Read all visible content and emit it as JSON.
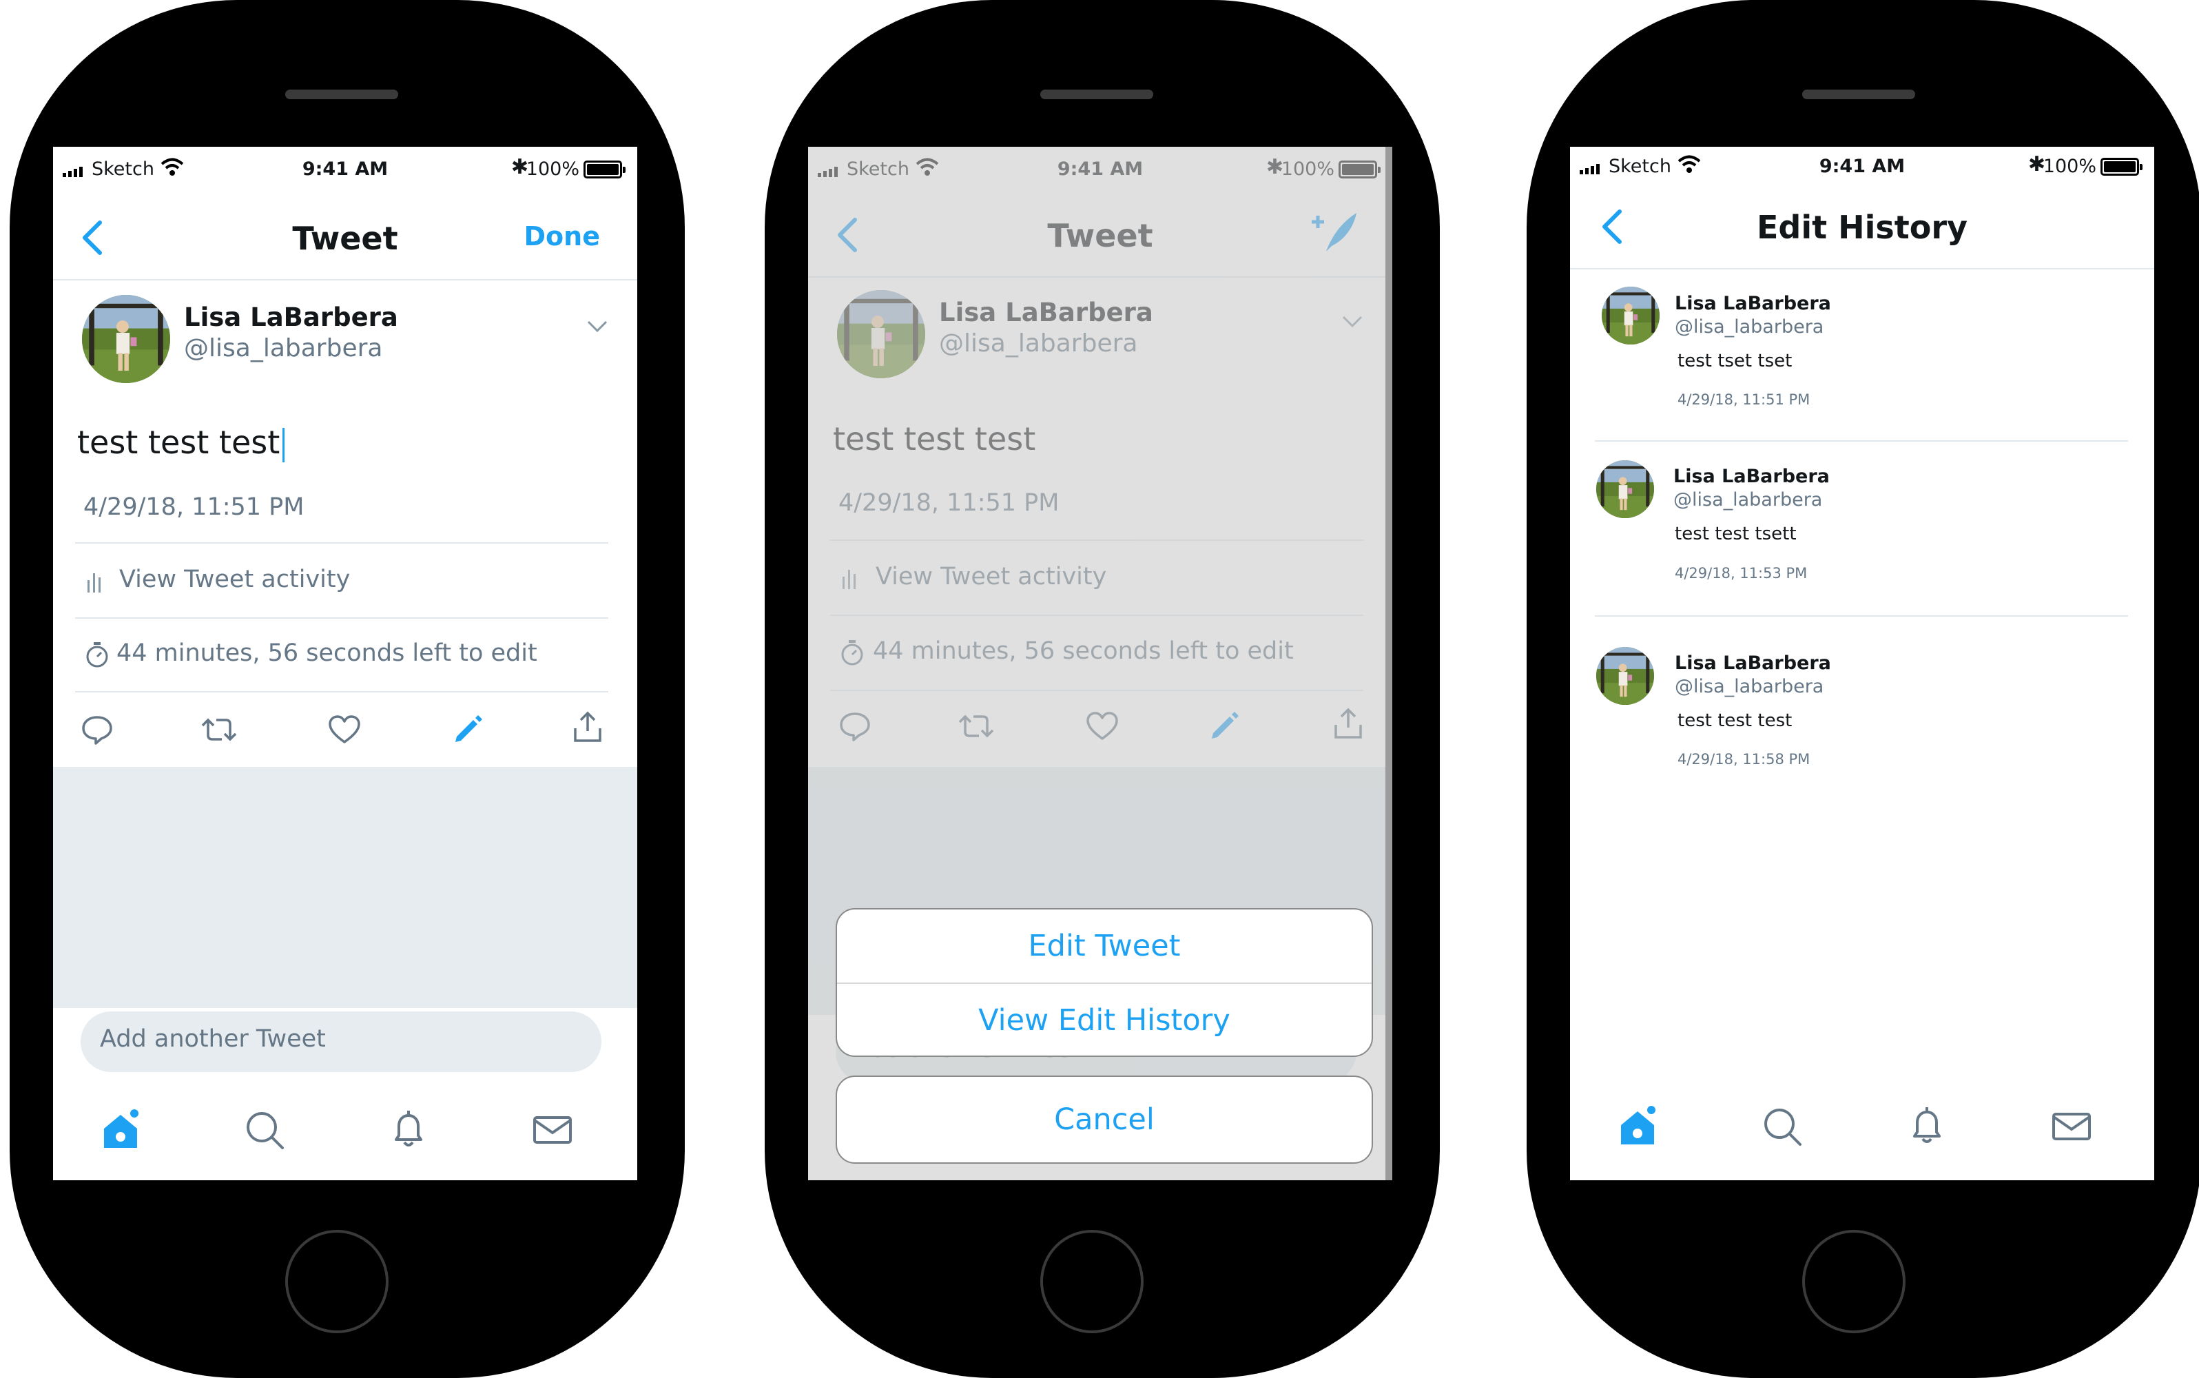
{
  "status_bar": {
    "carrier": "Sketch",
    "time": "9:41 AM",
    "battery": "100%"
  },
  "tweet": {
    "nav_title": "Tweet",
    "done_label": "Done",
    "author_name": "Lisa LaBarbera",
    "author_handle": "@lisa_labarbera",
    "text": "test test test",
    "timestamp": "4/29/18, 11:51 PM",
    "activity_label": "View Tweet activity",
    "edit_time_label": "44 minutes, 56 seconds left to edit",
    "add_tweet_placeholder": "Add another Tweet"
  },
  "action_sheet": {
    "edit_tweet": "Edit Tweet",
    "view_edit_history": "View Edit History",
    "cancel": "Cancel"
  },
  "edit_history": {
    "title": "Edit History",
    "entries": [
      {
        "name": "Lisa LaBarbera",
        "handle": "@lisa_labarbera",
        "text": "test tset tset",
        "time": "4/29/18, 11:51 PM"
      },
      {
        "name": "Lisa LaBarbera",
        "handle": "@lisa_labarbera",
        "text": "test test tsett",
        "time": "4/29/18, 11:53 PM"
      },
      {
        "name": "Lisa LaBarbera",
        "handle": "@lisa_labarbera",
        "text": "test test test",
        "time": "4/29/18, 11:58 PM"
      }
    ]
  },
  "colors": {
    "accent": "#1da1f2",
    "muted": "#657786",
    "divider": "#e1e8ed",
    "compose_bg": "#e6ecf0"
  },
  "icons": {
    "tabs": [
      "home-icon",
      "search-icon",
      "notifications-icon",
      "messages-icon"
    ],
    "actions": [
      "reply-icon",
      "retweet-icon",
      "like-icon",
      "edit-icon",
      "share-icon"
    ]
  }
}
